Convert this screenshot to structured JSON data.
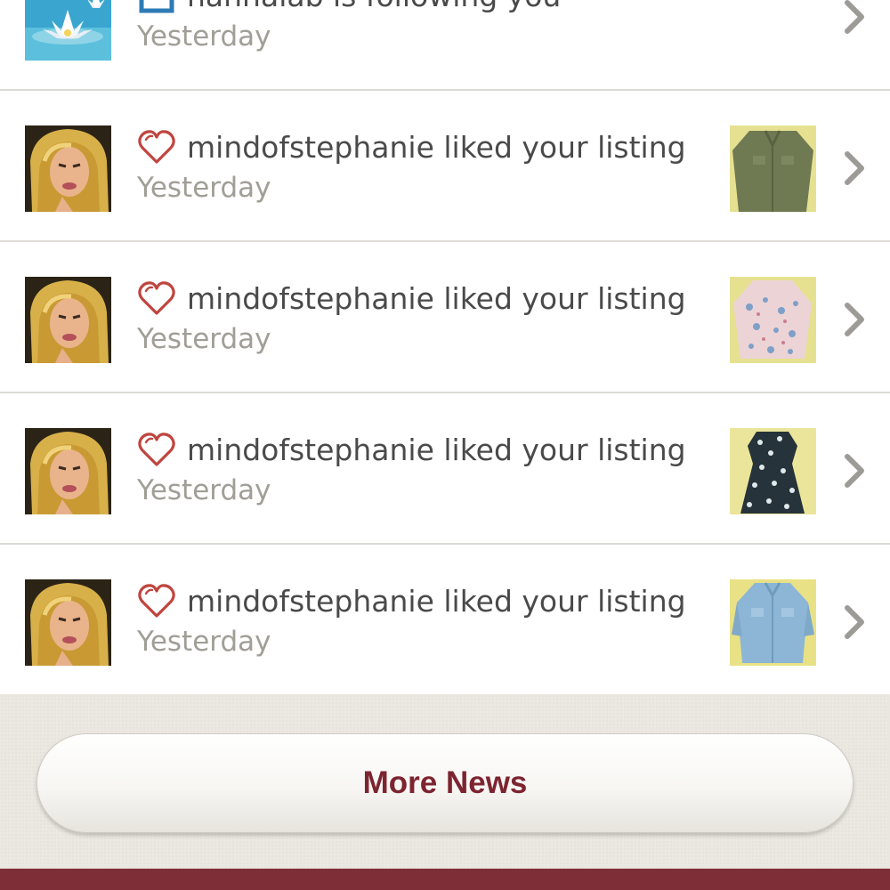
{
  "news": [
    {
      "avatar": "lotus-avatar",
      "activity": "follow",
      "activity_icon": "follow-icon",
      "text": "hannalab is following you",
      "time": "Yesterday"
    },
    {
      "avatar": "user-avatar",
      "activity": "like",
      "activity_icon": "heart-icon",
      "text": "mindofstephanie liked your listing",
      "time": "Yesterday",
      "thumbnail": "olive-shirt"
    },
    {
      "avatar": "user-avatar",
      "activity": "like",
      "activity_icon": "heart-icon",
      "text": "mindofstephanie liked your listing",
      "time": "Yesterday",
      "thumbnail": "floral-blouse"
    },
    {
      "avatar": "user-avatar",
      "activity": "like",
      "activity_icon": "heart-icon",
      "text": "mindofstephanie liked your listing",
      "time": "Yesterday",
      "thumbnail": "floral-dress"
    },
    {
      "avatar": "user-avatar",
      "activity": "like",
      "activity_icon": "heart-icon",
      "text": "mindofstephanie liked your listing",
      "time": "Yesterday",
      "thumbnail": "denim-shirt"
    }
  ],
  "more_button": {
    "label": "More News"
  },
  "colors": {
    "accent": "#7d2430",
    "heart": "#c0453f",
    "follow": "#2d7bb6",
    "text": "#4a4a4a",
    "muted": "#a09e96",
    "bottom_bar": "#7e2e36"
  }
}
